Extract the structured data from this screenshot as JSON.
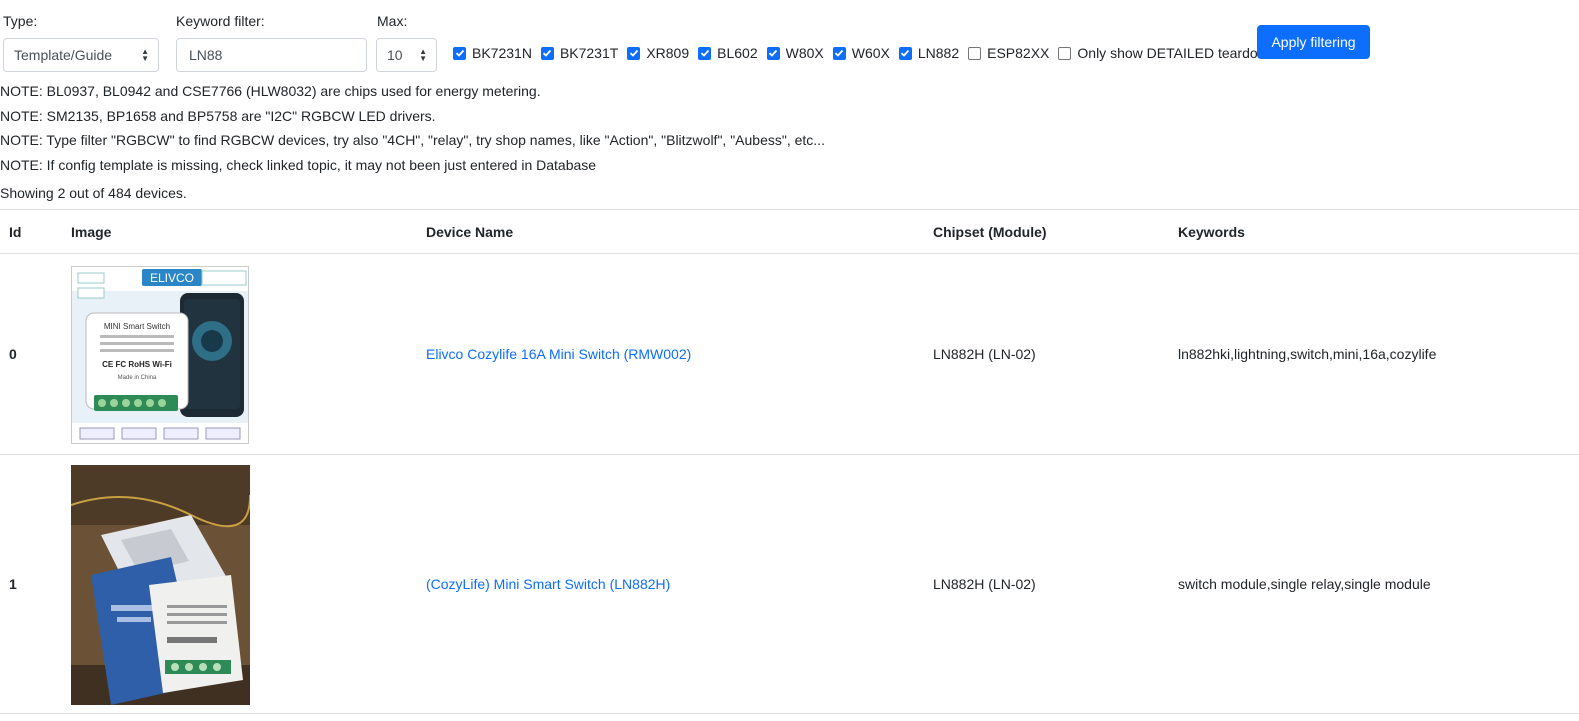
{
  "filters": {
    "type_label": "Type:",
    "type_value": "Template/Guide",
    "keyword_label": "Keyword filter:",
    "keyword_value": "LN88",
    "max_label": "Max:",
    "max_value": "10",
    "chipsets": [
      {
        "label": "BK7231N",
        "checked": true
      },
      {
        "label": "BK7231T",
        "checked": true
      },
      {
        "label": "XR809",
        "checked": true
      },
      {
        "label": "BL602",
        "checked": true
      },
      {
        "label": "W80X",
        "checked": true
      },
      {
        "label": "W60X",
        "checked": true
      },
      {
        "label": "LN882",
        "checked": true
      },
      {
        "label": "ESP82XX",
        "checked": false
      }
    ],
    "detailed_label": "Only show DETAILED teardowns",
    "detailed_checked": false,
    "apply_label": "Apply filtering"
  },
  "notes": [
    "NOTE: BL0937, BL0942 and CSE7766 (HLW8032) are chips used for energy metering.",
    "NOTE: SM2135, BP1658 and BP5758 are \"I2C\" RGBCW LED drivers.",
    "NOTE: Type filter \"RGBCW\" to find RGBCW devices, try also \"4CH\", \"relay\", try shop names, like \"Action\", \"Blitzwolf\", \"Aubess\", etc...",
    "NOTE: If config template is missing, check linked topic, it may not been just entered in Database"
  ],
  "count_text": "Showing 2 out of 484 devices.",
  "table": {
    "headers": {
      "id": "Id",
      "image": "Image",
      "name": "Device Name",
      "chipset": "Chipset (Module)",
      "keywords": "Keywords"
    },
    "rows": [
      {
        "id": "0",
        "name": "Elivco Cozylife 16A Mini Switch (RMW002)",
        "chipset": "LN882H (LN-02)",
        "keywords": "ln882hki,lightning,switch,mini,16a,cozylife",
        "image_text": {
          "brand": "ELIVCO",
          "product": "MINI  Smart  Switch",
          "made_in": "Made in China",
          "marks": "CE FC RoHS  Wi-Fi"
        }
      },
      {
        "id": "1",
        "name": "(CozyLife) Mini Smart Switch (LN882H)",
        "chipset": "LN882H (LN-02)",
        "keywords": "switch module,single relay,single module"
      }
    ]
  },
  "colors": {
    "accent": "#0d6efd",
    "text": "#212529",
    "border": "#dee2e6"
  }
}
